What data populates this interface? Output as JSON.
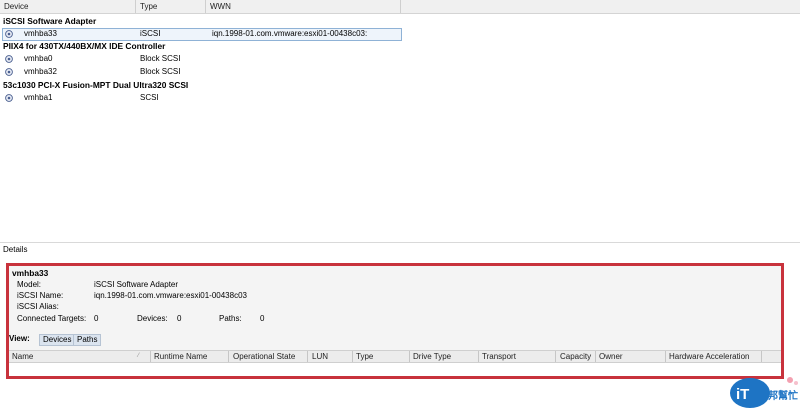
{
  "list_header": {
    "device": "Device",
    "type": "Type",
    "wwn": "WWN"
  },
  "groups": [
    {
      "name": "iSCSI Software Adapter",
      "rows": [
        {
          "device": "vmhba33",
          "type": "iSCSI",
          "wwn": "iqn.1998-01.com.vmware:esxi01-00438c03:",
          "selected": true
        }
      ]
    },
    {
      "name": "PIIX4 for 430TX/440BX/MX IDE Controller",
      "rows": [
        {
          "device": "vmhba0",
          "type": "Block SCSI",
          "wwn": ""
        },
        {
          "device": "vmhba32",
          "type": "Block SCSI",
          "wwn": ""
        }
      ]
    },
    {
      "name": "53c1030 PCI-X Fusion-MPT Dual Ultra320 SCSI",
      "rows": [
        {
          "device": "vmhba1",
          "type": "SCSI",
          "wwn": ""
        }
      ]
    }
  ],
  "details": {
    "title": "Details",
    "adapter": "vmhba33",
    "model_label": "Model:",
    "model_value": "iSCSI Software Adapter",
    "iscsi_name_label": "iSCSI Name:",
    "iscsi_name_value": "iqn.1998-01.com.vmware:esxi01-00438c03",
    "iscsi_alias_label": "iSCSI Alias:",
    "iscsi_alias_value": "",
    "connected_targets_label": "Connected Targets:",
    "connected_targets_value": "0",
    "devices_label": "Devices:",
    "devices_value": "0",
    "paths_label": "Paths:",
    "paths_value": "0",
    "view_label": "View:",
    "view_devices": "Devices",
    "view_paths": "Paths",
    "columns": [
      "Name",
      "Runtime Name",
      "Operational State",
      "LUN",
      "Type",
      "Drive Type",
      "Transport",
      "Capacity",
      "Owner",
      "Hardware Acceleration"
    ]
  },
  "watermark": {
    "text": "iT邦幫忙"
  },
  "colors": {
    "highlight_border": "#c8323c",
    "selection_border": "#8fb2d6"
  }
}
